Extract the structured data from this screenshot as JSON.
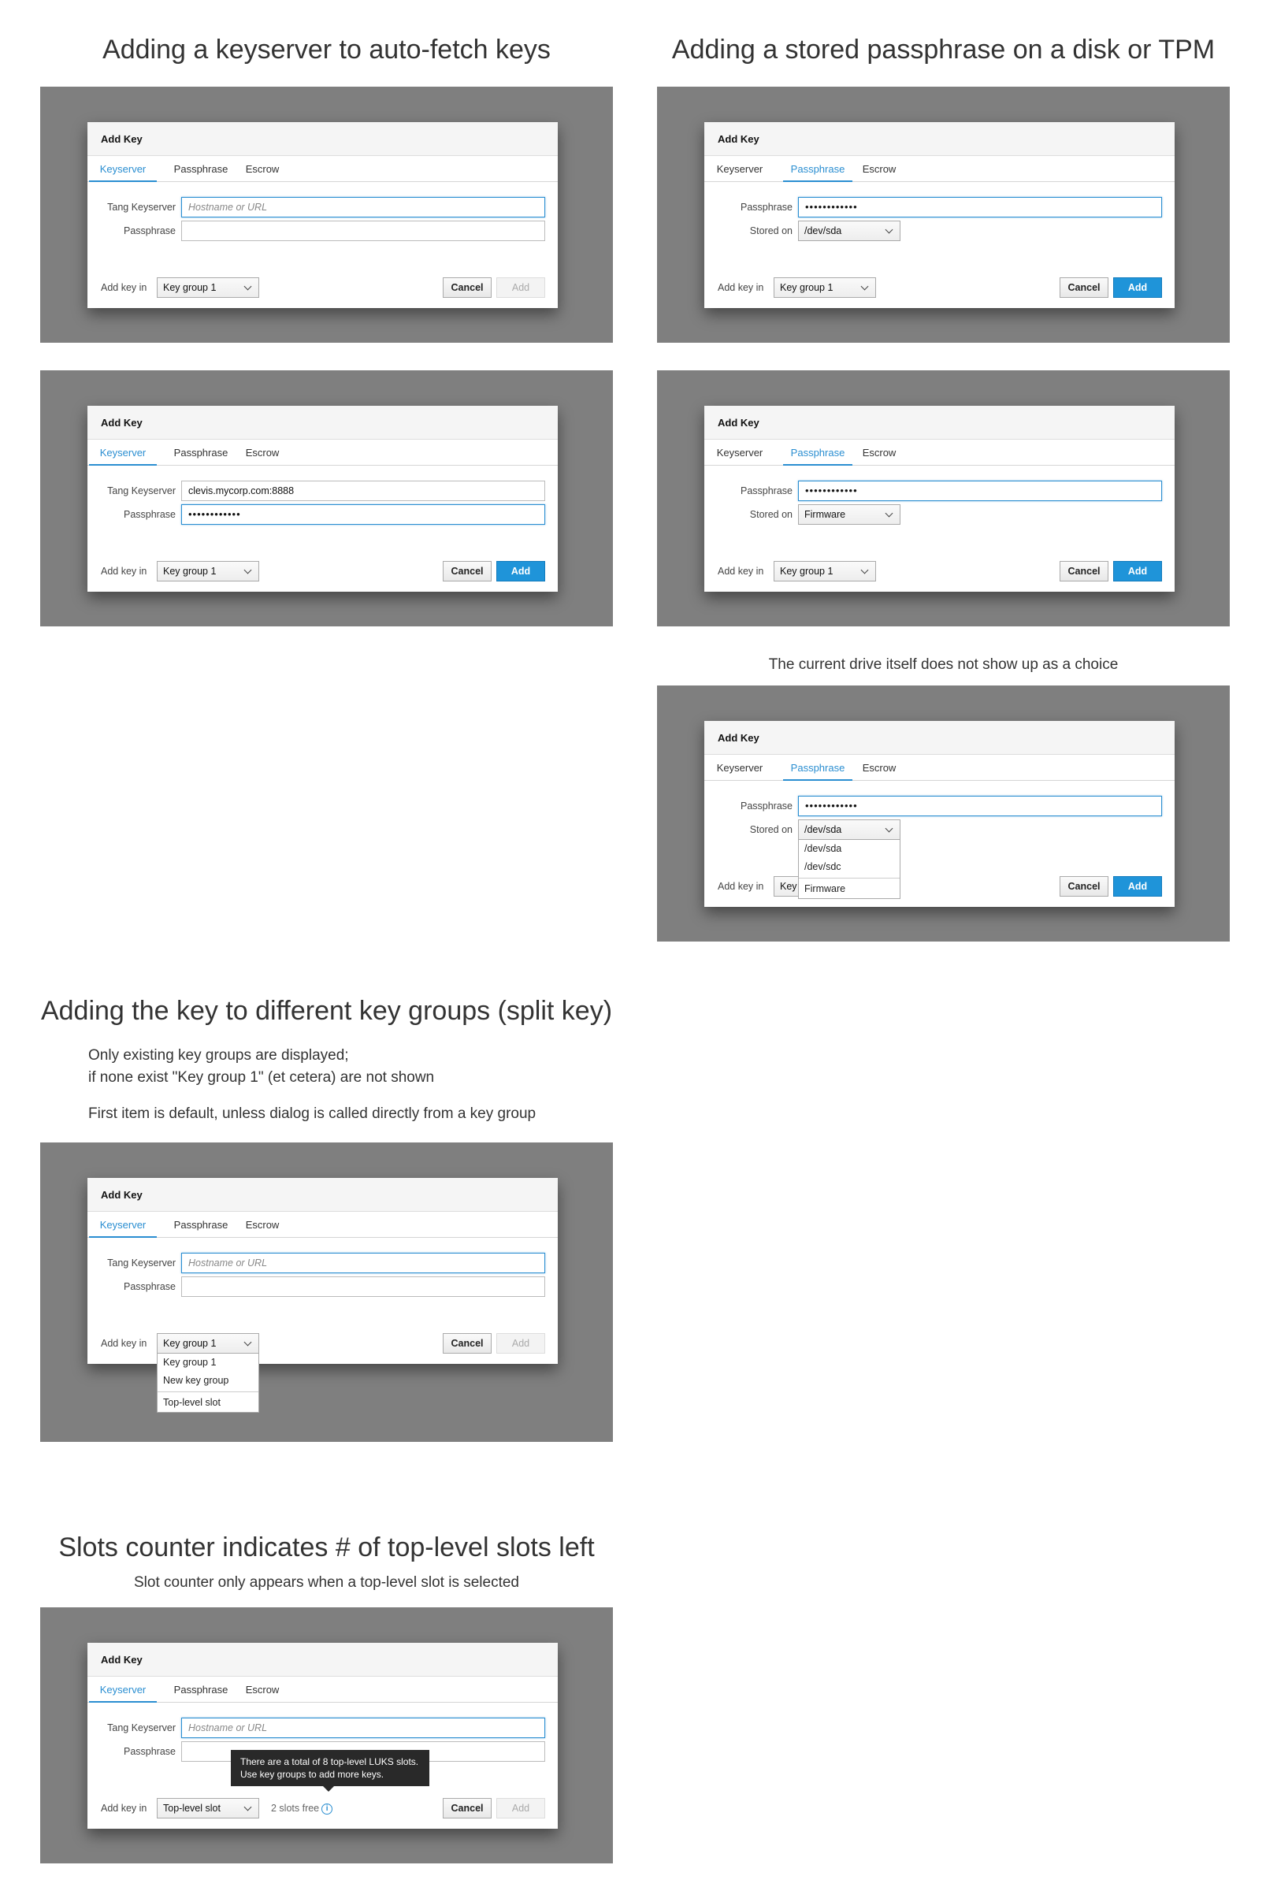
{
  "headings": {
    "keyserver": "Adding a keyserver to auto-fetch keys",
    "passphrase": "Adding a stored passphrase on a disk or TPM",
    "groups": "Adding the key to different key groups (split key)",
    "slots": "Slots counter indicates # of top-level slots left"
  },
  "notes": {
    "drive": "The current drive itself does not show up as a choice",
    "groups_line1": "Only existing key groups are displayed;",
    "groups_line2": "if none exist \"Key group 1\" (et cetera) are not shown",
    "groups_line3": "First item is default, unless dialog is called directly from a key group",
    "slots": "Slot counter only appears when a top-level slot is selected"
  },
  "dialog": {
    "title": "Add Key",
    "tabs": [
      "Keyserver",
      "Passphrase",
      "Escrow"
    ],
    "tang_label": "Tang Keyserver",
    "passphrase_label": "Passphrase",
    "stored_on_label": "Stored on",
    "add_key_in_label": "Add key in",
    "cancel_label": "Cancel",
    "add_label": "Add",
    "placeholder": "Hostname or URL",
    "key_group_value": "Key group 1",
    "top_level_value": "Top-level slot",
    "masked": "••••••••••••",
    "tang_value": "clevis.mycorp.com:8888",
    "dev_sda": "/dev/sda",
    "firmware": "Firmware"
  },
  "stored_on_options": [
    "/dev/sda",
    "/dev/sdc",
    "Firmware"
  ],
  "group_options": [
    "Key group 1",
    "New key group",
    "Top-level slot"
  ],
  "slots": {
    "free_text": "2 slots free",
    "tooltip": "There are a total of 8 top-level LUKS slots. Use key groups to add more keys."
  },
  "colors": {
    "panel_bg": "#7f7f7f",
    "accent": "#2a8ed1",
    "primary_button": "#1f94d9"
  }
}
